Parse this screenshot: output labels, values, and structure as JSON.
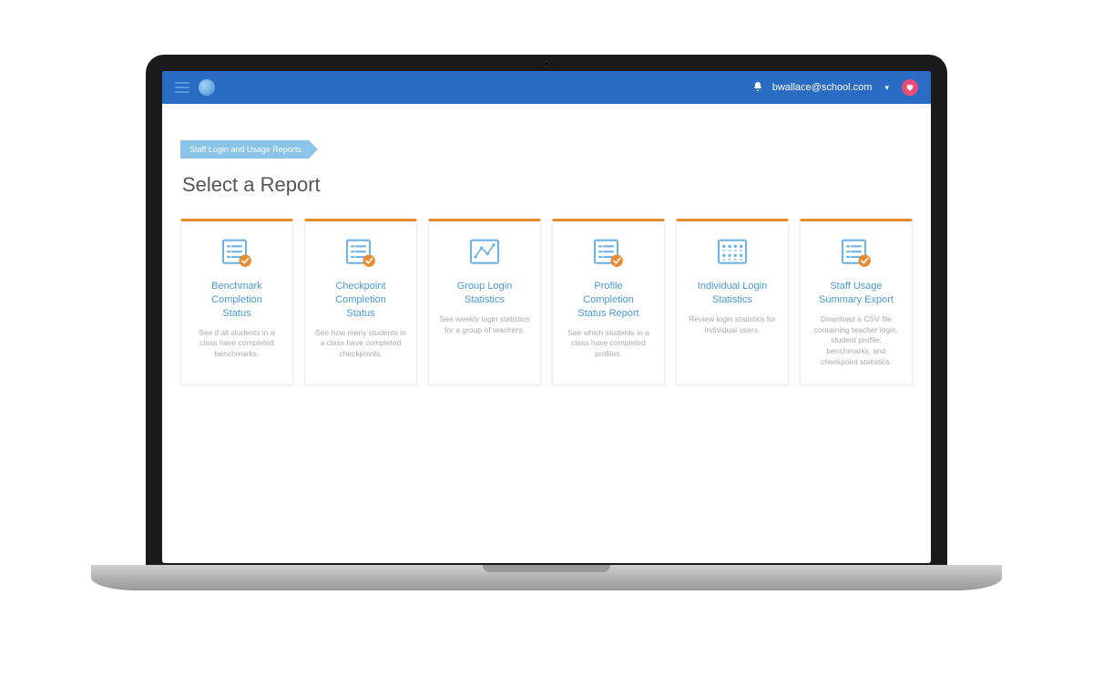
{
  "header": {
    "user_email": "bwallace@school.com"
  },
  "breadcrumb": {
    "label": "Staff Login and Usage Reports"
  },
  "page": {
    "title": "Select a Report"
  },
  "reports": [
    {
      "icon": "list-check",
      "title": "Benchmark\nCompletion\nStatus",
      "desc": "See if all students in a class have completed benchmarks."
    },
    {
      "icon": "list-check",
      "title": "Checkpoint\nCompletion\nStatus",
      "desc": "See how many students in a class have completed checkpoints."
    },
    {
      "icon": "line-chart",
      "title": "Group Login\nStatistics",
      "desc": "See weekly login statistics for a group of teachers."
    },
    {
      "icon": "list-check",
      "title": "Profile\nCompletion\nStatus Report",
      "desc": "See which students in a class have completed profiles."
    },
    {
      "icon": "people-grid",
      "title": "Individual Login\nStatistics",
      "desc": "Review login statistics for individual users."
    },
    {
      "icon": "list-check",
      "title": "Staff Usage\nSummary Export",
      "desc": "Download a CSV file containing teacher login, student profile, benchmarks, and checkpoint statistics."
    }
  ],
  "colors": {
    "header_bg": "#2a6bc4",
    "accent_orange": "#e18a2e",
    "link_blue": "#4a99d4",
    "breadcrumb_bg": "#8ac4e8",
    "heart_badge": "#ec4d74"
  }
}
